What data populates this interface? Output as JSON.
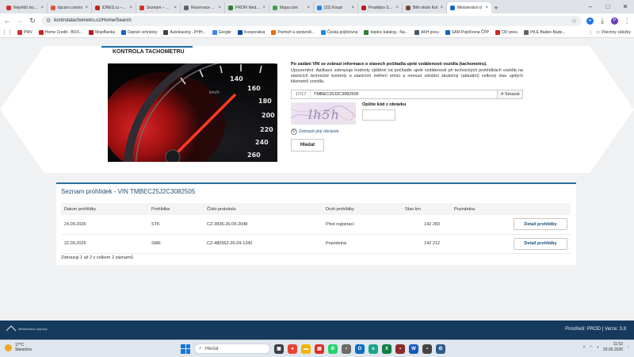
{
  "browser": {
    "tabs": [
      {
        "label": "Největší inzerc",
        "color": "#d93025",
        "active": false
      },
      {
        "label": "tipcars.com/ro",
        "color": "#e0553b",
        "active": false
      },
      {
        "label": "iDNES.cz – s n",
        "color": "#c5221f",
        "active": false
      },
      {
        "label": "Seznam – nejl",
        "color": "#d93025",
        "active": false
      },
      {
        "label": "Rezervace | Re",
        "color": "#5f6368",
        "active": false
      },
      {
        "label": "PROFI hledání",
        "color": "#2e7d32",
        "active": false
      },
      {
        "label": "Mapy.com",
        "color": "#43a047",
        "active": false
      },
      {
        "label": "(32) Koupi",
        "color": "#1e88e5",
        "active": false
      },
      {
        "label": "Prostějov Start",
        "color": "#b71c1c",
        "active": false
      },
      {
        "label": "Běh okolo Krá",
        "color": "#6d4c41",
        "active": false
      },
      {
        "label": "Ministerstvo d",
        "color": "#1565c0",
        "active": true
      }
    ],
    "url": "kontrolatachometru.cz/Home/Search",
    "bookmarks": [
      {
        "label": "PMV",
        "color": "#d32f2f"
      },
      {
        "label": "Home Credit - BOX...",
        "color": "#c62828"
      },
      {
        "label": "MojeBanka",
        "color": "#b71c1c"
      },
      {
        "label": "Datové schránky",
        "color": "#1565c0"
      },
      {
        "label": "Autoleasing - PHH...",
        "color": "#424242"
      },
      {
        "label": "Google",
        "color": "#4285f4"
      },
      {
        "label": "Kooperativa",
        "color": "#0d47a1"
      },
      {
        "label": "Partneři a oprávněl...",
        "color": "#ef6c00"
      },
      {
        "label": "Česká pojišťovna",
        "color": "#1e88e5"
      },
      {
        "label": "tepdoc katalog - Na...",
        "color": "#2e7d32"
      },
      {
        "label": "AKH pneu",
        "color": "#455a64"
      },
      {
        "label": "SAM Pojišťovna ČPP",
        "color": "#1565c0"
      },
      {
        "label": "DD pneu",
        "color": "#c62828"
      },
      {
        "label": "IHLE Baden-Bade...",
        "color": "#5f6368"
      }
    ],
    "all_bookmarks_label": "Všechny záložky"
  },
  "page": {
    "section_title": "KONTROLA TACHOMETRU",
    "form": {
      "heading": "Po zadání VIN se zobrazí informace o stavech počítadla ujeté vzdálenosti vozidla (tachometru).",
      "note": "Upozornění: Aplikace zobrazuje hodnoty zjištěné na počítadle ujeté vzdálenosti při technických prohlídkách vozidla na stanicích technické kontroly a stanicích měření emisí a nemusí odrážet skutečný (aktuální) celkový stav ujetých kilometrů vozidla.",
      "vin_counter": "17/17",
      "vin_value": "TMBEC25J2C3082505",
      "clear_label": "Smazat",
      "captcha_text": "lh5h",
      "captcha_label": "Opište kód z obrázku",
      "refresh_label": "Zobrazit jiný obrázek",
      "search_label": "Hledat"
    },
    "results": {
      "title": "Seznam prohlídek - VIN TMBEC25J2C3082505",
      "columns": [
        "Datum prohlídky",
        "Prohlídka",
        "Číslo protokolu",
        "Druh prohlídky",
        "Stav km",
        "Poznámka"
      ],
      "rows": [
        {
          "date": "24.09.2026",
          "type": "STK",
          "protocol": "CZ-3836-26-09-2048",
          "kind": "Před registrací",
          "km": "142 283",
          "note": "",
          "action": "Detail prohlídky"
        },
        {
          "date": "22.09.2026",
          "type": "SME",
          "protocol": "CZ-480562-26-09-1342",
          "kind": "Pravidelná",
          "km": "142 212",
          "note": "",
          "action": "Detail prohlídky"
        }
      ],
      "pager": "Zobrazuji 1 až 2 z celkem 2 záznamů"
    },
    "footer": {
      "logo_text": "Ministerstvo dopravy",
      "env": "Prostředí: PROD | Verze: 3.8"
    }
  },
  "taskbar": {
    "weather_temp": "17°C",
    "weather_desc": "Slunečno",
    "search_placeholder": "Hledat",
    "time": "11:03",
    "date": "29.09.2026"
  }
}
